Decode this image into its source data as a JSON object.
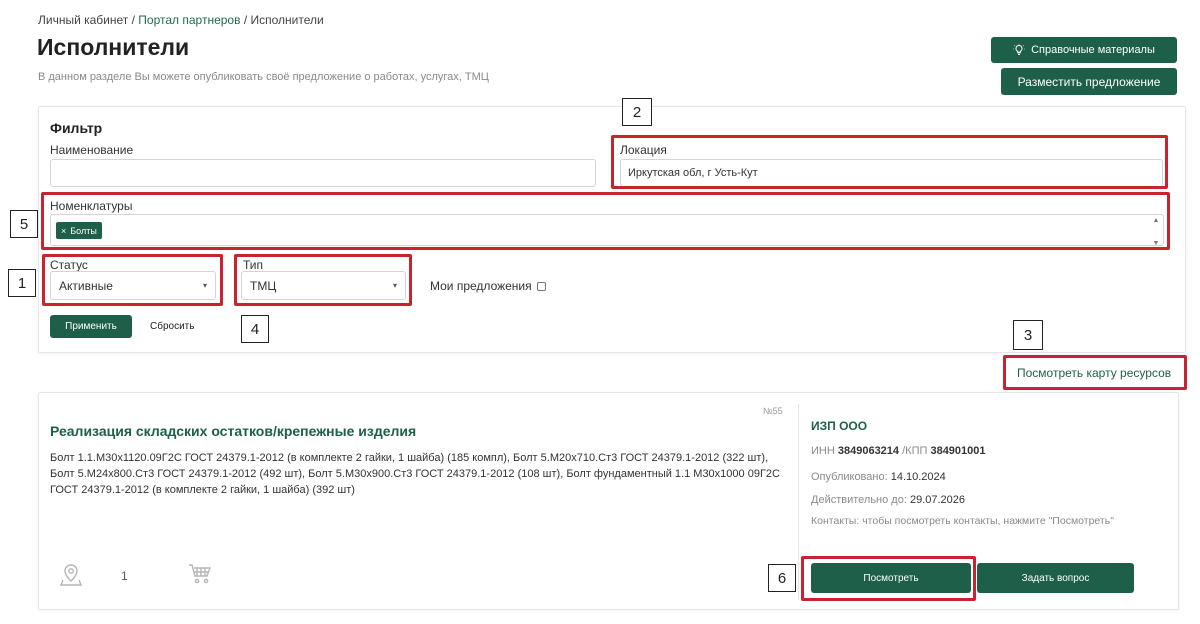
{
  "breadcrumb": {
    "home": "Личный кабинет",
    "sep": " / ",
    "portal": "Портал партнеров",
    "current": "Исполнители"
  },
  "page": {
    "title": "Исполнители",
    "subtitle": "В данном разделе Вы можете опубликовать своё предложение о работах, услугах, ТМЦ"
  },
  "header_buttons": {
    "reference": "Справочные материалы",
    "place_offer": "Разместить предложение"
  },
  "filter": {
    "title": "Фильтр",
    "name_label": "Наименование",
    "name_value": "",
    "location_label": "Локация",
    "location_value": "Иркутская обл, г Усть-Кут",
    "nomenclature_label": "Номенклатуры",
    "nomenclature_tags": [
      "Болты"
    ],
    "status_label": "Статус",
    "status_value": "Активные",
    "type_label": "Тип",
    "type_value": "ТМЦ",
    "my_offers_label": "Мои предложения",
    "apply": "Применить",
    "reset": "Сбросить"
  },
  "map_link": "Посмотреть карту ресурсов",
  "annotations": [
    "1",
    "2",
    "3",
    "4",
    "5",
    "6"
  ],
  "card": {
    "number": "№55",
    "title": "Реализация складских остатков/крепежные изделия",
    "description": "Болт 1.1.М30х1120.09Г2С ГОСТ 24379.1-2012 (в комплекте 2 гайки, 1 шайба) (185 компл), Болт 5.М20х710.Ст3 ГОСТ 24379.1-2012 (322 шт), Болт 5.М24х800.Ст3 ГОСТ 24379.1-2012 (492 шт), Болт 5.М30х900.Ст3 ГОСТ 24379.1-2012 (108 шт), Болт фундаментный 1.1 М30х1000 09Г2С ГОСТ 24379.1-2012 (в комплекте 2 гайки, 1 шайба) (392 шт)",
    "location_count": "1",
    "company": "ИЗП ООО",
    "inn_label": "ИНН",
    "inn": "3849063214",
    "kpp_label": "/КПП",
    "kpp": "384901001",
    "published_label": "Опубликовано:",
    "published": "14.10.2024",
    "valid_label": "Действительно до:",
    "valid": "29.07.2026",
    "contacts": "Контакты: чтобы посмотреть контакты, нажмите \"Посмотреть\"",
    "view_button": "Посмотреть",
    "ask_button": "Задать вопрос"
  },
  "colors": {
    "accent": "#1d5f49",
    "annotation_red": "#c9232f"
  }
}
